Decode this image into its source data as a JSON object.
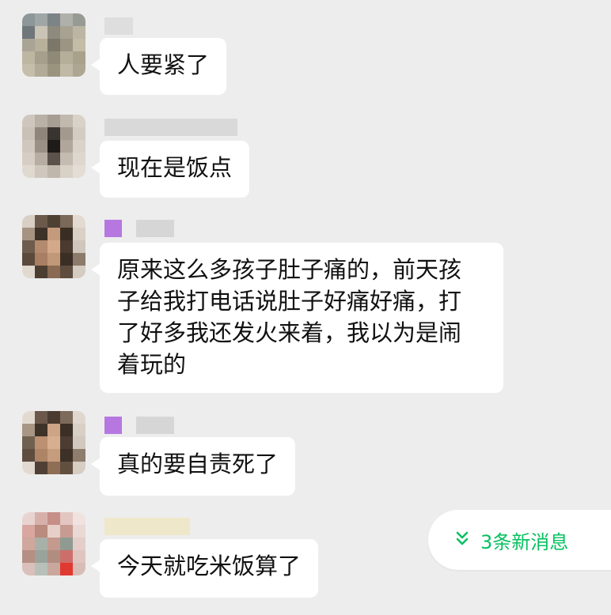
{
  "messages": [
    {
      "text": "人要紧了"
    },
    {
      "text": "现在是饭点"
    },
    {
      "text": "原来这么多孩子肚子痛的，前天孩\n子给我打电话说肚子好痛好痛，打\n了好多我还发火来着，我以为是闹\n着玩的"
    },
    {
      "text": "真的要自责死了"
    },
    {
      "text": "今天就吃米饭算了"
    }
  ],
  "new_messages": {
    "label": "3条新消息",
    "icon": "chevron-double-down-icon"
  },
  "colors": {
    "background": "#ededed",
    "bubble": "#ffffff",
    "accent": "#07c160"
  }
}
